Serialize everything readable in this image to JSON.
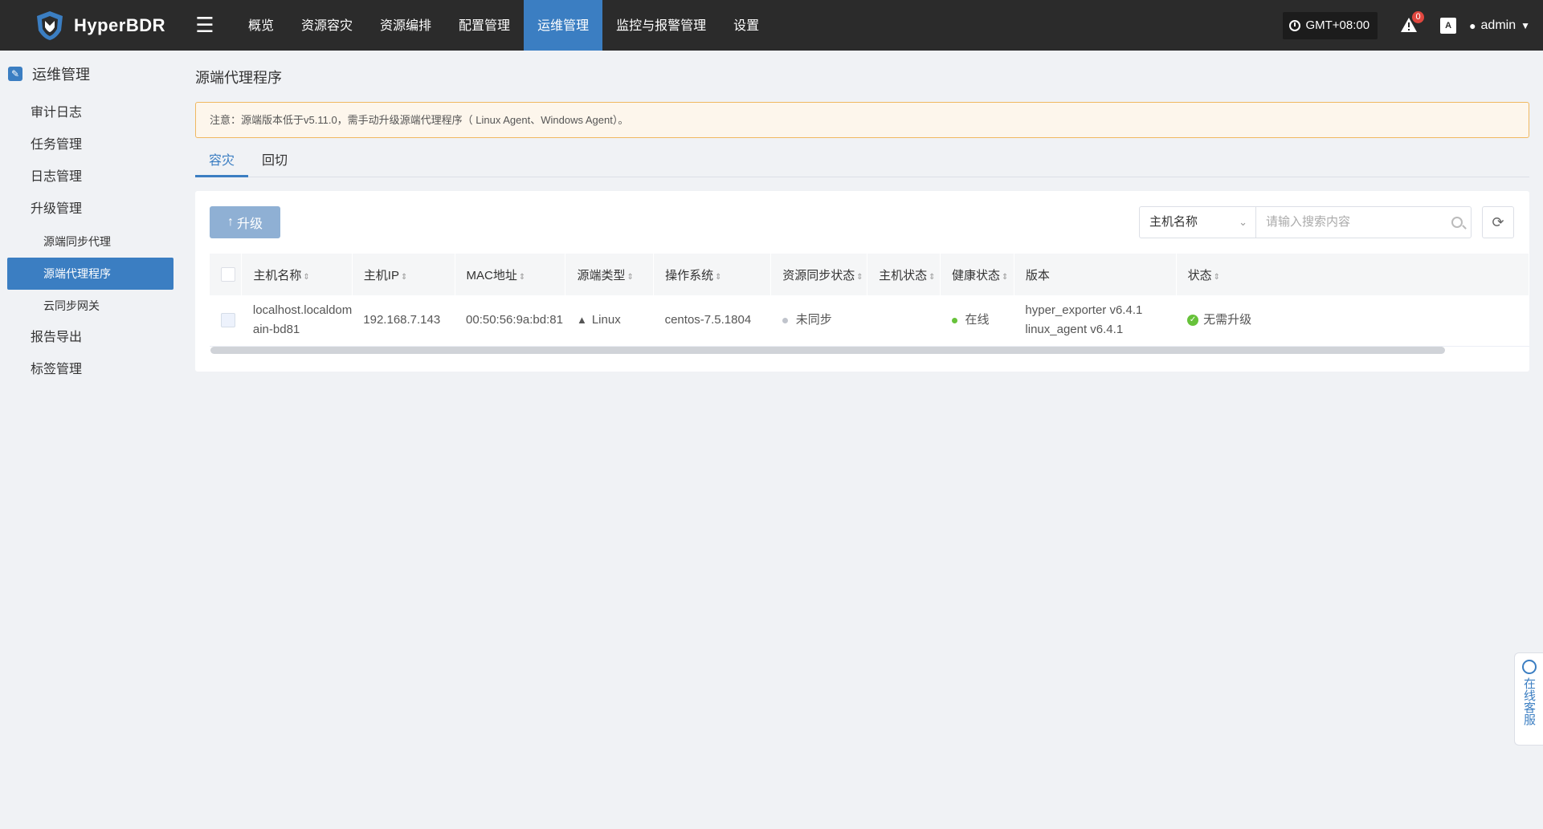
{
  "app": {
    "name": "HyperBDR"
  },
  "nav": [
    {
      "label": "概览",
      "active": false
    },
    {
      "label": "资源容灾",
      "active": false
    },
    {
      "label": "资源编排",
      "active": false
    },
    {
      "label": "配置管理",
      "active": false
    },
    {
      "label": "运维管理",
      "active": true
    },
    {
      "label": "监控与报警管理",
      "active": false
    },
    {
      "label": "设置",
      "active": false
    }
  ],
  "header": {
    "timezone": "GMT+08:00",
    "alert_count": "0",
    "lang_icon": "A",
    "user": "admin"
  },
  "sidebar": {
    "title": "运维管理",
    "items": [
      {
        "label": "审计日志"
      },
      {
        "label": "任务管理"
      },
      {
        "label": "日志管理"
      },
      {
        "label": "升级管理"
      },
      {
        "label": "源端同步代理"
      },
      {
        "label": "源端代理程序"
      },
      {
        "label": "云同步网关"
      },
      {
        "label": "报告导出"
      },
      {
        "label": "标签管理"
      }
    ]
  },
  "page": {
    "title": "源端代理程序",
    "notice": "注意：源端版本低于v5.11.0，需手动升级源端代理程序（ Linux Agent、Windows Agent）。",
    "tabs": [
      {
        "label": "容灾",
        "active": true
      },
      {
        "label": "回切",
        "active": false
      }
    ]
  },
  "toolbar": {
    "upgrade_label": "升级",
    "filter_selected": "主机名称",
    "search_placeholder": "请输入搜索内容"
  },
  "table": {
    "columns": [
      "主机名称",
      "主机IP",
      "MAC地址",
      "源端类型",
      "操作系统",
      "资源同步状态",
      "主机状态",
      "健康状态",
      "版本",
      "状态"
    ],
    "rows": [
      {
        "hostname_line1": "localhost.localdom",
        "hostname_line2": "ain-bd81",
        "ip": "192.168.7.143",
        "mac": "00:50:56:9a:bd:81",
        "source_type": "Linux",
        "os": "centos-7.5.1804",
        "sync_status": "未同步",
        "host_status": "",
        "health": "在线",
        "version_line1": "hyper_exporter v6.4.1",
        "version_line2": "linux_agent v6.4.1",
        "status": "无需升级"
      }
    ]
  },
  "service": {
    "label": "在线客服"
  },
  "colors": {
    "accent": "#3b7ec2",
    "header_bg": "#2b2b2b",
    "notice_border": "#f0b861",
    "success": "#67c23a"
  }
}
